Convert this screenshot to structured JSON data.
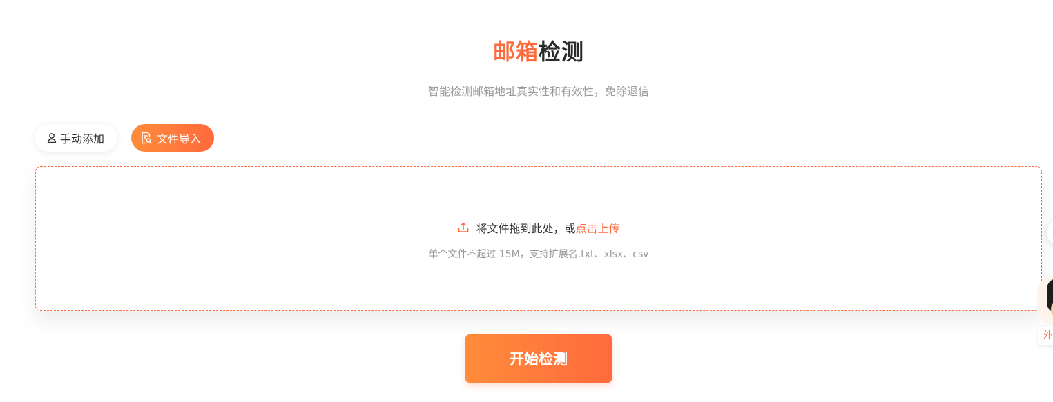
{
  "header": {
    "title_accent": "邮箱",
    "title_rest": "检测",
    "subtitle": "智能检测邮箱地址真实性和有效性，免除退信"
  },
  "tabs": [
    {
      "label": "手动添加",
      "icon": "user-icon",
      "active": false
    },
    {
      "label": "文件导入",
      "icon": "file-search-icon",
      "active": true
    }
  ],
  "dropzone": {
    "icon": "upload-icon",
    "text": "将文件拖到此处，或",
    "link": "点击上传",
    "hint": "单个文件不超过 15M，支持扩展名.txt、xlsx、csv"
  },
  "start_button": {
    "label": "开始检测"
  },
  "floating": {
    "label": "外",
    "icon": "avatar-icon"
  },
  "colors": {
    "accent": "#ff6a3d",
    "accent_start": "#ff8c3a",
    "text_dark": "#2b2b2b",
    "text_muted": "#999999"
  }
}
